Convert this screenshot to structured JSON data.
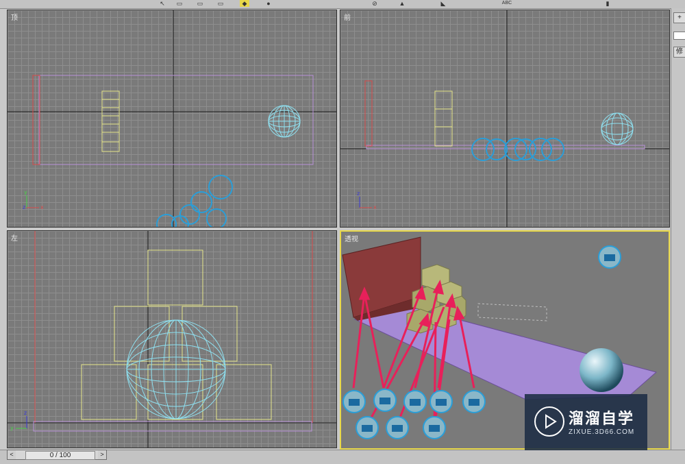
{
  "toolbar": {
    "icons": [
      "select-arrow-icon",
      "select-region-icon",
      "window-crossing-icon",
      "move-icon",
      "rotate-icon",
      "scale-icon",
      "snap-icon",
      "mirror-icon",
      "align-icon",
      "abc-icon",
      "layers-icon"
    ],
    "abc_text": "ABC"
  },
  "viewports": {
    "top": {
      "label": "顶"
    },
    "front": {
      "label": "前"
    },
    "left": {
      "label": "左"
    },
    "perspective": {
      "label": "透视"
    }
  },
  "axes": {
    "x": "x",
    "y": "y",
    "z": "z"
  },
  "right_panel": {
    "modify_tab": "修",
    "plus_label": "+"
  },
  "timeline": {
    "frame_text": "0 / 100",
    "prev": "<",
    "next": ">"
  },
  "watermark": {
    "title": "溜溜自学",
    "url": "ZIXUE.3D66.COM"
  },
  "colors": {
    "viewport_bg": "#7a7a7a",
    "grid": "#8e8e8e",
    "active_border": "#e8d84a",
    "sphere_wire": "#8ee0f0",
    "box_wire": "#e6e68a",
    "wall_wire": "#d84a4a",
    "plane_wire": "#b890d8",
    "arrow": "#e8205a",
    "helper": "#2a9ed8"
  }
}
